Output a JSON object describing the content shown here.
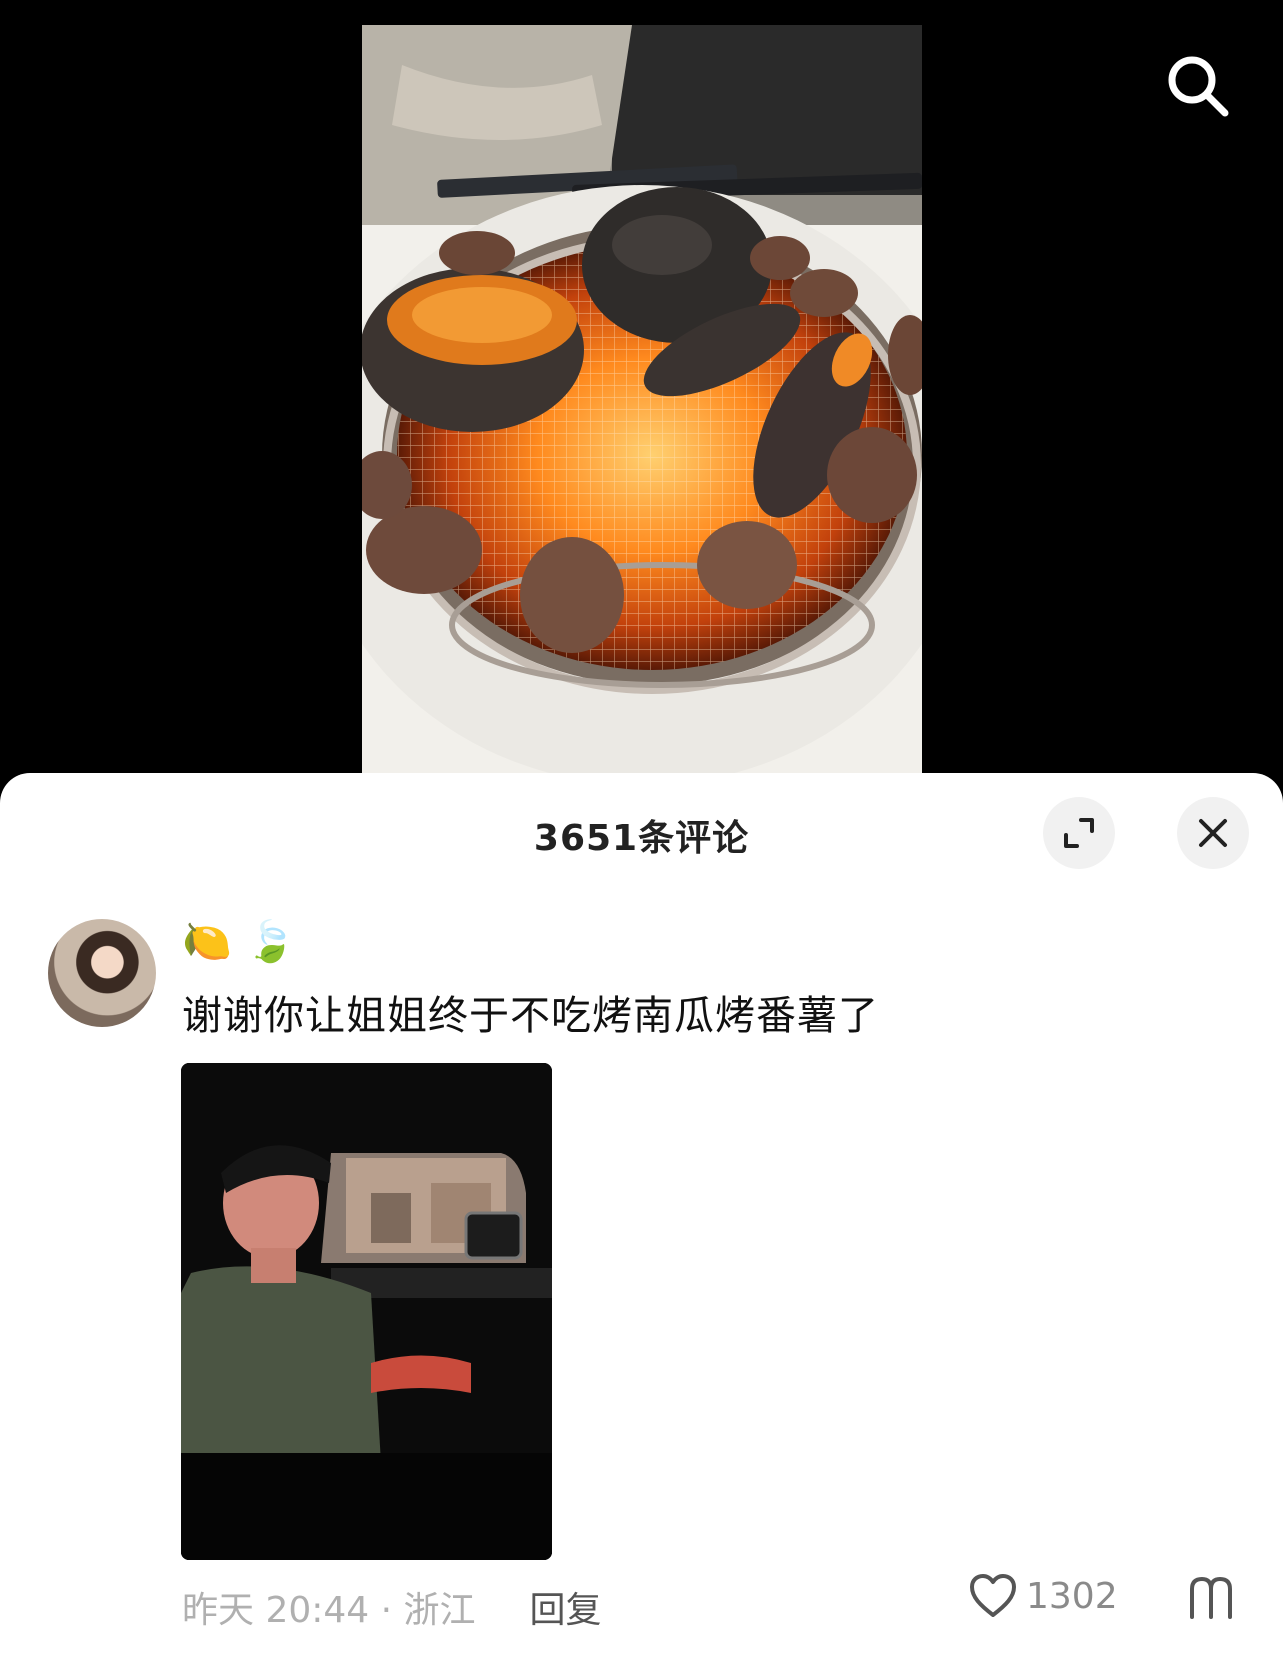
{
  "header": {
    "search_icon": "search-icon"
  },
  "sheet": {
    "title": "3651条评论",
    "expand_icon": "expand-icon",
    "close_icon": "close-icon"
  },
  "comment": {
    "emojis": [
      "🍋",
      "🍃"
    ],
    "text": "谢谢你让姐姐终于不吃烤南瓜烤番薯了",
    "time_location": "昨天 20:44 · 浙江",
    "reply_label": "回复",
    "like_count": "1302",
    "like_icon": "heart-icon",
    "dislike_icon": "dislike-icon"
  },
  "colors": {
    "background_video": "#000000",
    "sheet_bg": "#ffffff",
    "meta_text": "#b0b0b0",
    "primary_text": "#111111"
  }
}
